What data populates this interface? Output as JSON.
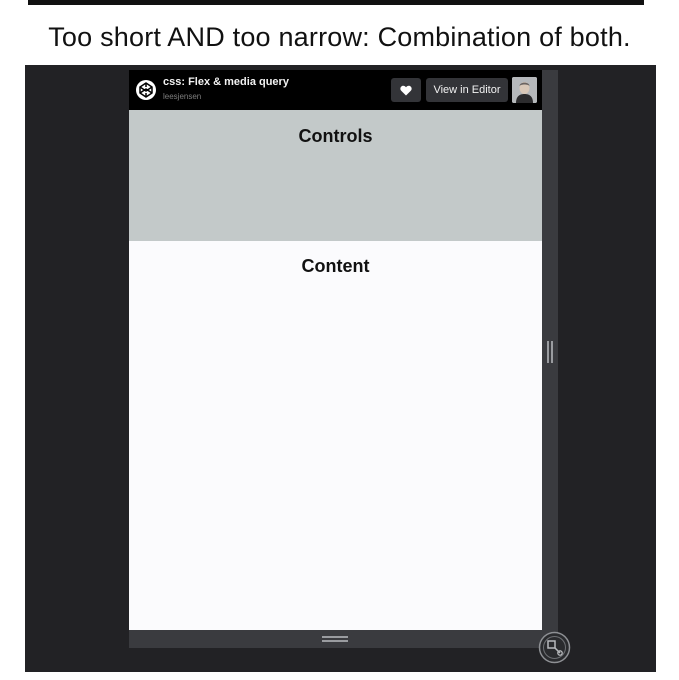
{
  "caption": "Too short AND too narrow: Combination of both.",
  "header": {
    "title": "css: Flex & media query",
    "author": "leesjensen",
    "logo_icon": "codepen-logo-icon",
    "like_icon": "heart-icon",
    "view_in_editor_label": "View in Editor",
    "avatar": "user-avatar"
  },
  "panels": {
    "controls": {
      "heading": "Controls",
      "background": "#c3c9c9"
    },
    "content": {
      "heading": "Content",
      "background": "#fbfbfd"
    }
  },
  "handles": {
    "right": "vertical-resize-handle",
    "bottom": "horizontal-resize-handle",
    "corner": "resize-corner-icon"
  },
  "colors": {
    "screen_background": "#222225",
    "frame_background": "#3a3b3f",
    "header_background": "#000000"
  }
}
